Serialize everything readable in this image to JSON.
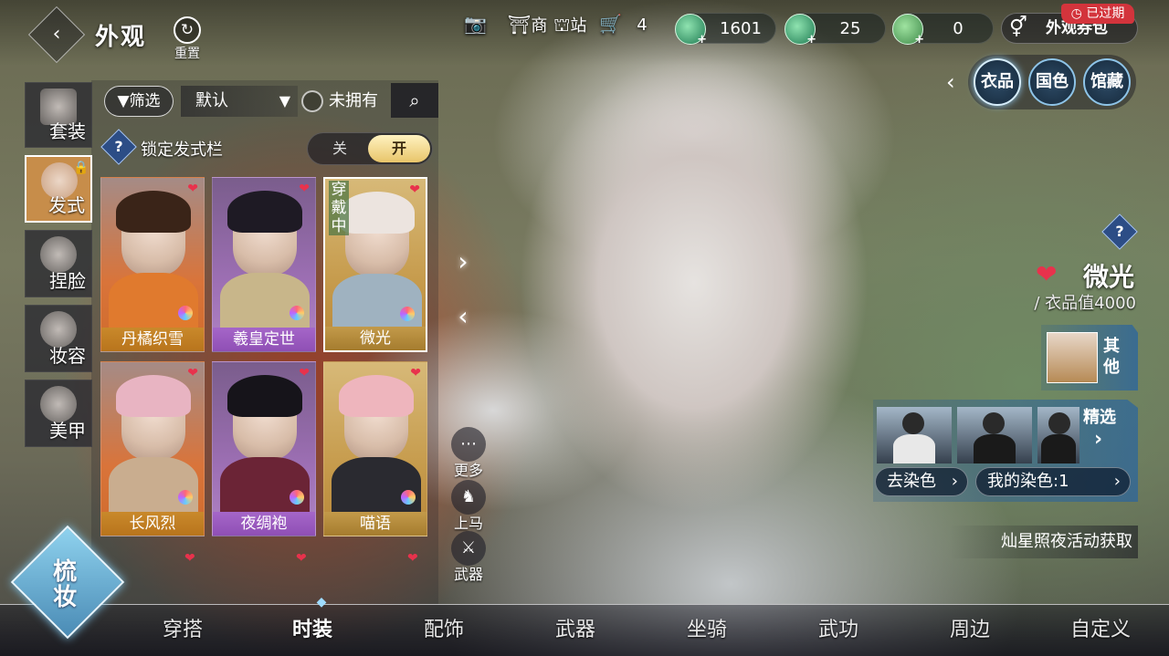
{
  "header": {
    "title": "外观",
    "reset_label": "重置",
    "cart_count": "4",
    "shop_label": "商",
    "station_label": "站"
  },
  "currencies": [
    {
      "value": "1601"
    },
    {
      "value": "25"
    },
    {
      "value": "0"
    }
  ],
  "coupon": {
    "label": "外观券包",
    "badge": "已过期"
  },
  "sidebar": {
    "items": [
      {
        "label": "套装"
      },
      {
        "label": "发式"
      },
      {
        "label": "捏脸"
      },
      {
        "label": "妆容"
      },
      {
        "label": "美甲"
      }
    ]
  },
  "filter": {
    "filter_label": "筛选",
    "sort_value": "默认",
    "not_owned_label": "未拥有",
    "lock_label": "锁定发式栏",
    "toggle_off": "关",
    "toggle_on": "开"
  },
  "cards": [
    {
      "name": "丹橘织雪",
      "wearing": ""
    },
    {
      "name": "羲皇定世",
      "wearing": ""
    },
    {
      "name": "微光",
      "wearing": "穿戴中"
    },
    {
      "name": "长风烈",
      "wearing": ""
    },
    {
      "name": "夜绸袍",
      "wearing": ""
    },
    {
      "name": "喵语",
      "wearing": ""
    }
  ],
  "side_actions": {
    "more": "更多",
    "mount": "上马",
    "weapon": "武器"
  },
  "right_tabs": [
    "衣品",
    "国色",
    "馆藏"
  ],
  "item": {
    "name": "微光",
    "value_text": "/ 衣品值4000",
    "other_label": "其他",
    "featured_label": "精选",
    "dye_label": "去染色",
    "my_dye_label": "我的染色:1",
    "source_text": "灿星照夜活动获取"
  },
  "comb_label": "梳妆",
  "bottom_tabs": [
    "穿搭",
    "时装",
    "配饰",
    "武器",
    "坐骑",
    "武功",
    "周边",
    "自定义"
  ]
}
